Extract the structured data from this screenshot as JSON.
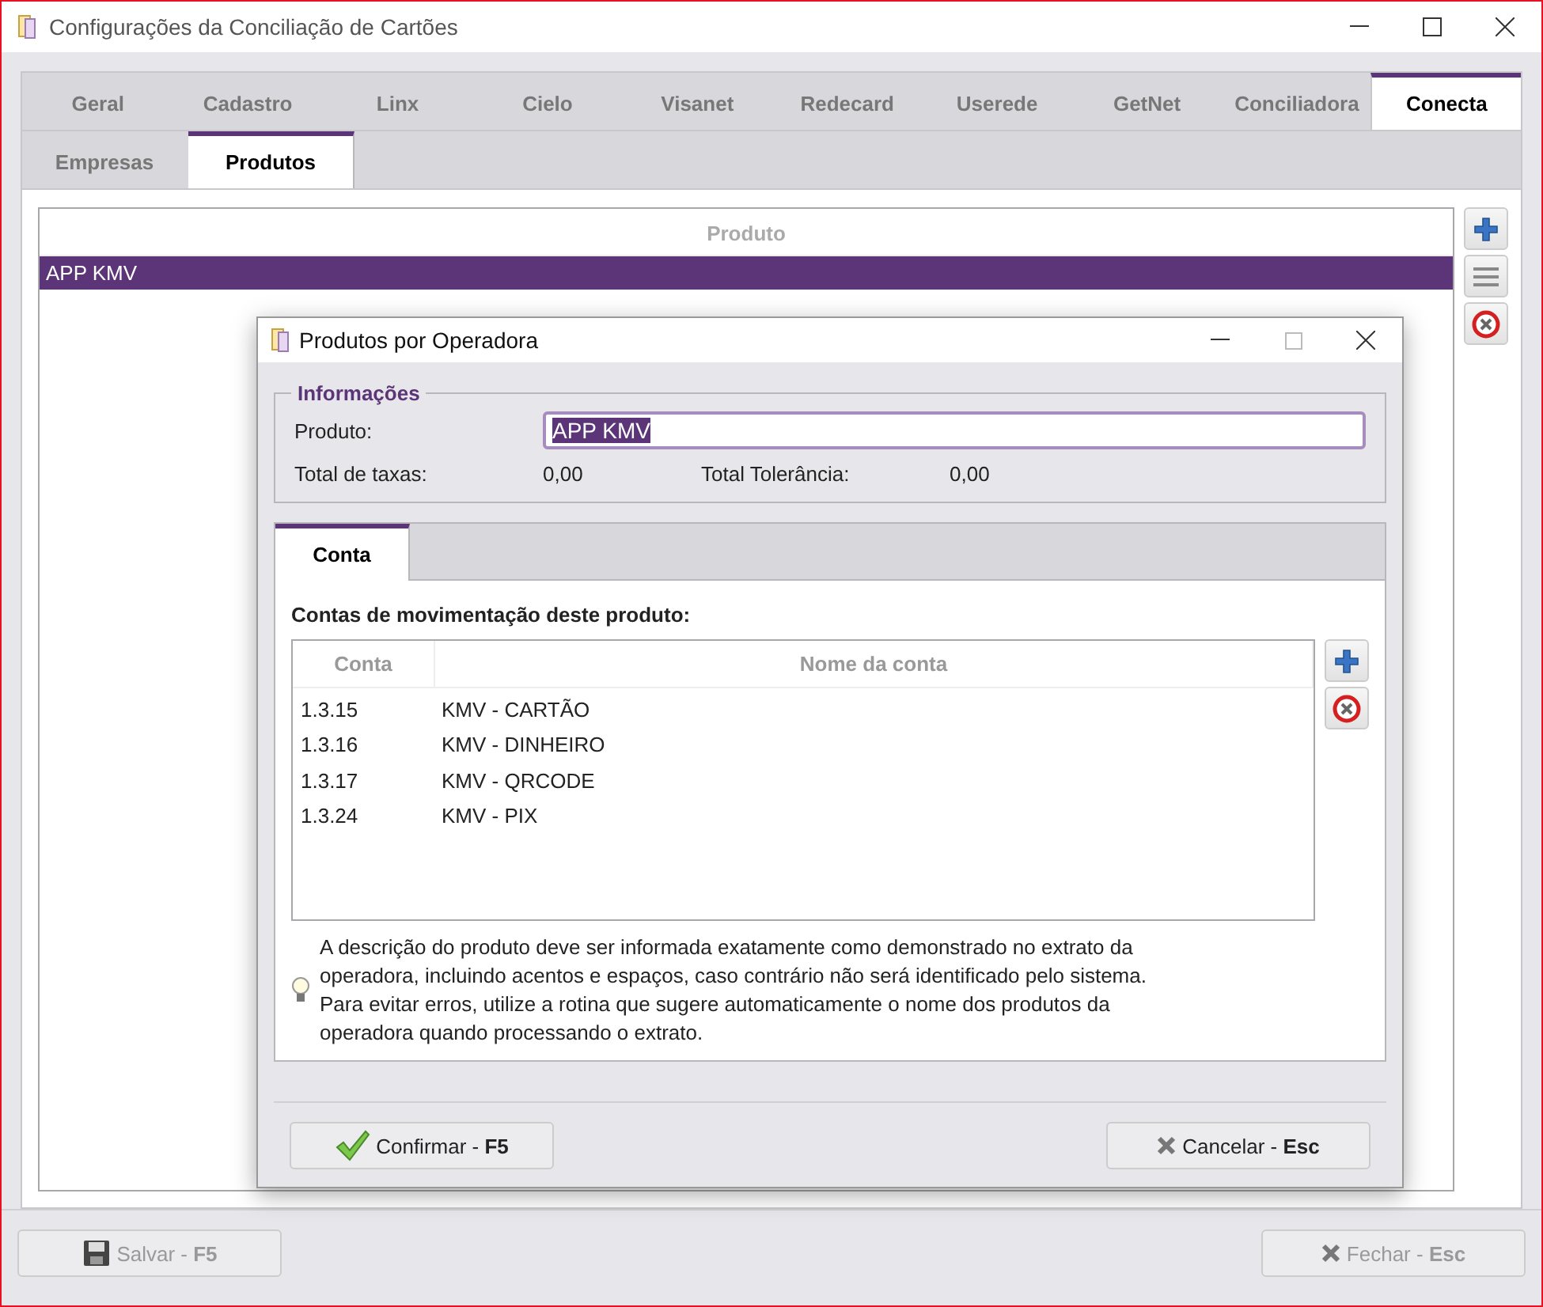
{
  "window": {
    "title": "Configurações da Conciliação de Cartões"
  },
  "tabs": [
    {
      "label": "Geral",
      "selected": false
    },
    {
      "label": "Cadastro",
      "selected": false
    },
    {
      "label": "Linx",
      "selected": false
    },
    {
      "label": "Cielo",
      "selected": false
    },
    {
      "label": "Visanet",
      "selected": false
    },
    {
      "label": "Redecard",
      "selected": false
    },
    {
      "label": "Userede",
      "selected": false
    },
    {
      "label": "GetNet",
      "selected": false
    },
    {
      "label": "Conciliadora",
      "selected": false
    },
    {
      "label": "Conecta",
      "selected": true
    }
  ],
  "subtabs": [
    {
      "label": "Empresas",
      "selected": false
    },
    {
      "label": "Produtos",
      "selected": true
    }
  ],
  "products": {
    "column": "Produto",
    "rows": [
      {
        "name": "APP KMV",
        "selected": true
      }
    ]
  },
  "footer_buttons": [
    {
      "label": "Salvar - **F5**",
      "kind": "save",
      "disabled": true
    },
    {
      "label": "Fechar - **Esc**",
      "kind": "close",
      "disabled": true
    }
  ],
  "dialog": {
    "title": "Produtos por Operadora",
    "group": "Informações",
    "product_label": "Produto:",
    "product_value": "APP KMV",
    "totals": [
      {
        "label": "Total de taxas:",
        "value": "0,00"
      },
      {
        "label": "Total Tolerância:",
        "value": "0,00"
      }
    ],
    "tabs": [
      {
        "label": "Conta",
        "selected": true
      }
    ],
    "accounts_heading": "Contas de movimentação deste produto:",
    "columns": [
      "Conta",
      "Nome da conta"
    ],
    "accounts": [
      {
        "code": "1.3.15",
        "name": "KMV - CARTÃO"
      },
      {
        "code": "1.3.16",
        "name": "KMV - DINHEIRO"
      },
      {
        "code": "1.3.17",
        "name": "KMV - QRCODE"
      },
      {
        "code": "1.3.24",
        "name": "KMV - PIX"
      }
    ],
    "hint": "A descrição do produto deve ser informada exatamente como demonstrado no extrato da operadora, incluindo acentos e espaços, caso contrário não será identificado pelo sistema. Para evitar erros, utilize a rotina que sugere automaticamente o nome dos produtos da operadora quando processando o extrato.",
    "buttons": [
      {
        "label": "Confirmar - **F5**",
        "kind": "confirm",
        "disabled": false
      },
      {
        "label": "Cancelar - **Esc**",
        "kind": "cancel",
        "disabled": false
      }
    ]
  }
}
